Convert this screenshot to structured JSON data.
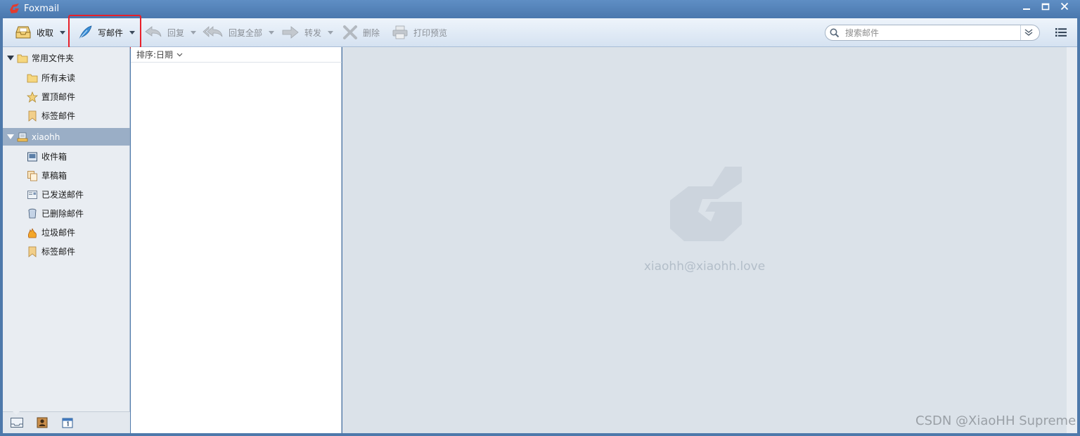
{
  "window": {
    "title": "Foxmail"
  },
  "toolbar": {
    "receive": "收取",
    "compose": "写邮件",
    "reply": "回复",
    "reply_all": "回复全部",
    "forward": "转发",
    "delete": "删除",
    "print_preview": "打印预览"
  },
  "search": {
    "placeholder": "搜索邮件",
    "value": ""
  },
  "sidebar": {
    "common_folders": {
      "label": "常用文件夹",
      "items": [
        {
          "label": "所有未读",
          "icon": "folder-icon"
        },
        {
          "label": "置顶邮件",
          "icon": "star-icon"
        },
        {
          "label": "标签邮件",
          "icon": "tag-icon"
        }
      ]
    },
    "account": {
      "label": "xiaohh",
      "items": [
        {
          "label": "收件箱",
          "icon": "inbox-icon"
        },
        {
          "label": "草稿箱",
          "icon": "drafts-icon"
        },
        {
          "label": "已发送邮件",
          "icon": "sent-icon"
        },
        {
          "label": "已删除邮件",
          "icon": "trash-icon"
        },
        {
          "label": "垃圾邮件",
          "icon": "junk-icon"
        },
        {
          "label": "标签邮件",
          "icon": "tag-icon"
        }
      ]
    },
    "bottom_buttons": [
      "mail-view-icon",
      "contacts-icon",
      "calendar-icon"
    ]
  },
  "message_list": {
    "sort_label": "排序:日期"
  },
  "reading_pane": {
    "account_email": "xiaohh@xiaohh.love"
  },
  "watermark": "CSDN @XiaoHH Supreme",
  "colors": {
    "title_bar": "#4a78ae",
    "highlight": "#e8202a",
    "selected_row": "#9aaec6"
  }
}
